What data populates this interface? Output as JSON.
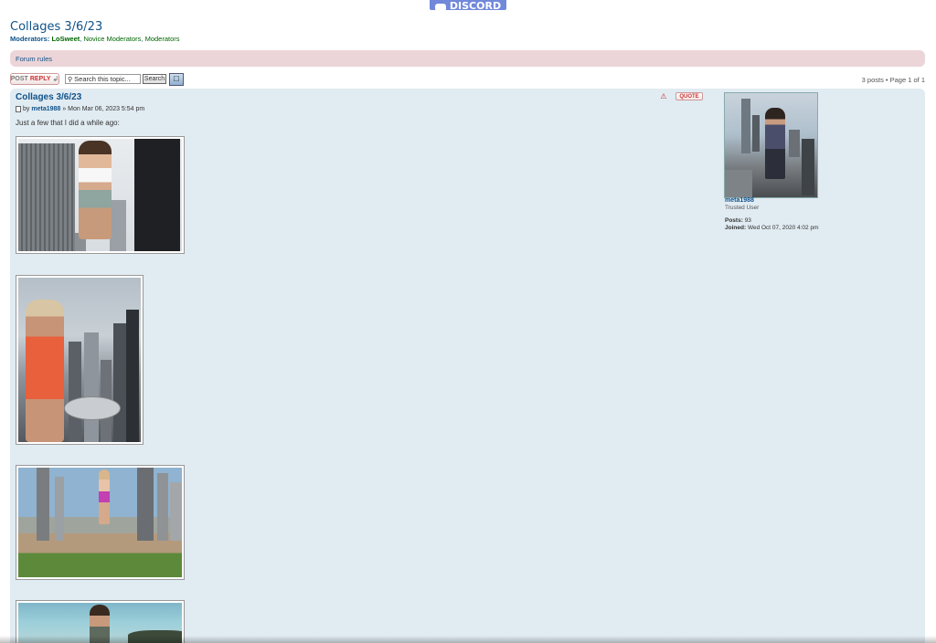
{
  "banner": {
    "label": "DISCORD"
  },
  "forum": {
    "title": "Collages 3/6/23",
    "moderators_label": "Moderators:",
    "moderators": [
      "LoSweet",
      "Novice Moderators",
      "Moderators"
    ],
    "separator": ", "
  },
  "rules": {
    "label": "Forum rules"
  },
  "actions": {
    "post_reply_a": "POST",
    "post_reply_b": "REPLY",
    "post_reply_icon": "reply-arrow-icon",
    "search_placeholder": "Search this topic...",
    "search_button": "Search",
    "pagination": "3 posts • Page 1 of 1"
  },
  "post": {
    "title": "Collages 3/6/23",
    "by": "by",
    "author": "meta1988",
    "date": "» Mon Mar 06, 2023 5:54 pm",
    "body": "Just a few that I did a while ago:",
    "quote_label": "QUOTE",
    "report_icon": "report-icon"
  },
  "profile": {
    "name": "meta1988",
    "rank": "Trusted User",
    "posts_label": "Posts:",
    "posts": "93",
    "joined_label": "Joined:",
    "joined": "Wed Oct 07, 2020 4:02 pm"
  },
  "colors": {
    "link": "#105289",
    "moderator": "#006600",
    "post_bg": "#e1ebf2",
    "rules_bg": "#ecd5d8",
    "discord": "#7289da"
  }
}
